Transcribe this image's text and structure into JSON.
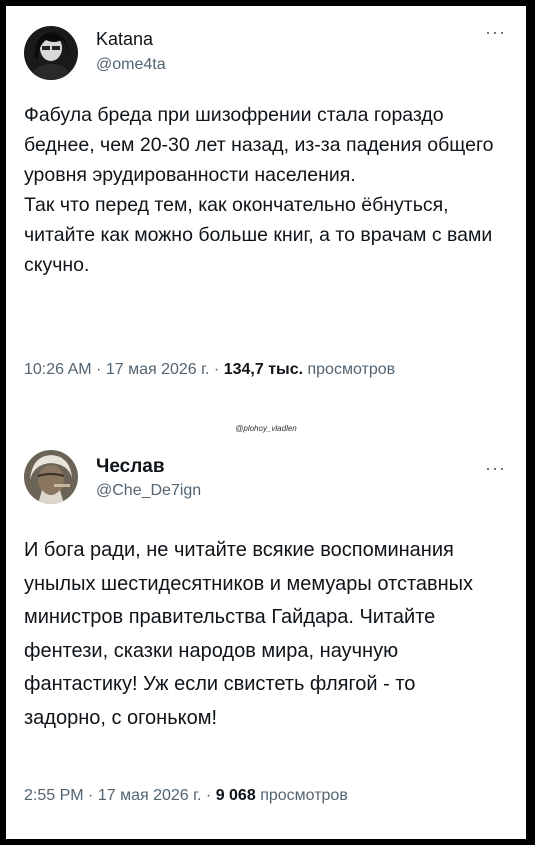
{
  "watermark": "@plohoy_vladlen",
  "tweets": [
    {
      "author_name": "Katana",
      "handle": "@ome4ta",
      "more_label": "···",
      "text": "Фабула бреда при шизофрении стала гораздо беднее, чем 20-30 лет назад, из-за падения общего уровня эрудированности населения.\nТак что перед тем, как окончательно ёбнуться, читайте как можно больше книг, а то врачам с вами скучно.",
      "time": "10:26 AM",
      "date": "17 мая 2026 г.",
      "views_count": "134,7 тыс.",
      "views_label": "просмотров",
      "separator": "·"
    },
    {
      "author_name": "Чеслав",
      "handle": "@Che_De7ign",
      "more_label": "···",
      "text": "И бога ради, не читайте всякие воспоминания унылых шестидесятников и мемуары отставных министров правительства Гайдара. Читайте фентези, сказки народов мира, научную фантастику! Уж если свистеть флягой - то задорно, с огоньком!",
      "time": "2:55 PM",
      "date": "17 мая 2026 г.",
      "views_count": "9 068",
      "views_label": "просмотров",
      "separator": "·"
    }
  ]
}
